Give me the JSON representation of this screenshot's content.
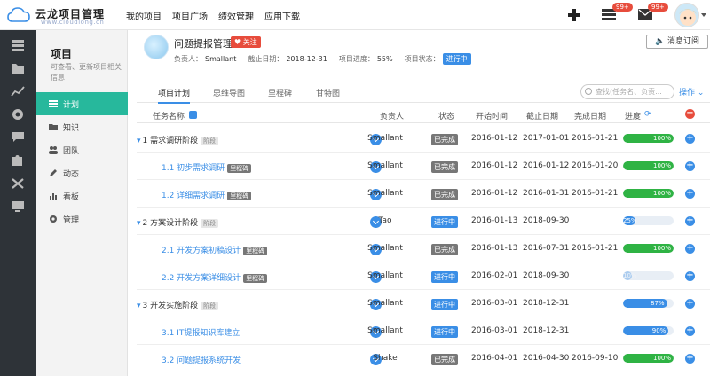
{
  "brand": {
    "name": "云龙项目管理",
    "domain": "www.cloudlong.cn"
  },
  "topnav": [
    "我的项目",
    "项目广场",
    "绩效管理",
    "应用下载"
  ],
  "top_badges": {
    "tasks": "99+",
    "messages": "99+"
  },
  "subnav": {
    "title": "项目",
    "desc": "可查看、更新项目相关信息",
    "items": [
      "计划",
      "知识",
      "团队",
      "动态",
      "看板",
      "管理"
    ]
  },
  "project": {
    "title": "问题提报管理",
    "follow": "关注",
    "owner_label": "负责人：",
    "owner": "Smallant",
    "deadline_label": "截止日期：",
    "deadline": "2018-12-31",
    "progress_label": "项目进度：",
    "progress": "55%",
    "status_label": "项目状态：",
    "status": "进行中",
    "subscribe": "消息订阅"
  },
  "tabs": [
    "项目计划",
    "思维导图",
    "里程碑",
    "甘特图"
  ],
  "search": {
    "placeholder": "查找(任务名、负责..."
  },
  "ops_label": "操作",
  "columns": [
    "任务名称",
    "负责人",
    "状态",
    "开始时间",
    "截止日期",
    "完成日期",
    "进度"
  ],
  "colors": {
    "accent": "#3a8ee6",
    "green": "#2fb344",
    "done_tag": "#777777",
    "active_nav": "#27b89c"
  },
  "rows": [
    {
      "name": "1 需求调研阶段",
      "tag": "阶段",
      "level": 0,
      "owner": "Smallant",
      "status": "已完成",
      "start": "2016-01-12",
      "due": "2017-01-01",
      "done": "2016-01-21",
      "progress": 100,
      "progress_text": "100%"
    },
    {
      "name": "1.1 初步需求调研",
      "tag": "里程碑",
      "level": 1,
      "owner": "Smallant",
      "status": "已完成",
      "start": "2016-01-12",
      "due": "2016-01-12",
      "done": "2016-01-20",
      "progress": 100,
      "progress_text": "100%"
    },
    {
      "name": "1.2 详细需求调研",
      "tag": "里程碑",
      "level": 1,
      "owner": "Smallant",
      "status": "已完成",
      "start": "2016-01-12",
      "due": "2016-01-31",
      "done": "2016-01-21",
      "progress": 100,
      "progress_text": "100%"
    },
    {
      "name": "2 方案设计阶段",
      "tag": "阶段",
      "level": 0,
      "owner": "Tao",
      "status": "进行中",
      "start": "2016-01-13",
      "due": "2018-09-30",
      "done": "",
      "progress": 25,
      "progress_text": "25%"
    },
    {
      "name": "2.1 开发方案初稿设计",
      "tag": "里程碑",
      "level": 1,
      "owner": "Smallant",
      "status": "已完成",
      "start": "2016-01-13",
      "due": "2016-07-31",
      "done": "2016-01-21",
      "progress": 100,
      "progress_text": "100%"
    },
    {
      "name": "2.2 开发方案详细设计",
      "tag": "里程碑",
      "level": 1,
      "owner": "Smallant",
      "status": "进行中",
      "start": "2016-02-01",
      "due": "2018-09-30",
      "done": "",
      "progress": 10,
      "progress_text": "10%"
    },
    {
      "name": "3 开发实施阶段",
      "tag": "阶段",
      "level": 0,
      "owner": "Smallant",
      "status": "进行中",
      "start": "2016-03-01",
      "due": "2018-12-31",
      "done": "",
      "progress": 87,
      "progress_text": "87%"
    },
    {
      "name": "3.1 IT提报知识库建立",
      "tag": "",
      "level": 1,
      "owner": "Smallant",
      "status": "进行中",
      "start": "2016-03-01",
      "due": "2018-12-31",
      "done": "",
      "progress": 90,
      "progress_text": "90%"
    },
    {
      "name": "3.2 问题提报系统开发",
      "tag": "",
      "level": 1,
      "owner": "Shake",
      "status": "已完成",
      "start": "2016-04-01",
      "due": "2016-04-30",
      "done": "2016-09-10",
      "progress": 100,
      "progress_text": "100%"
    }
  ]
}
